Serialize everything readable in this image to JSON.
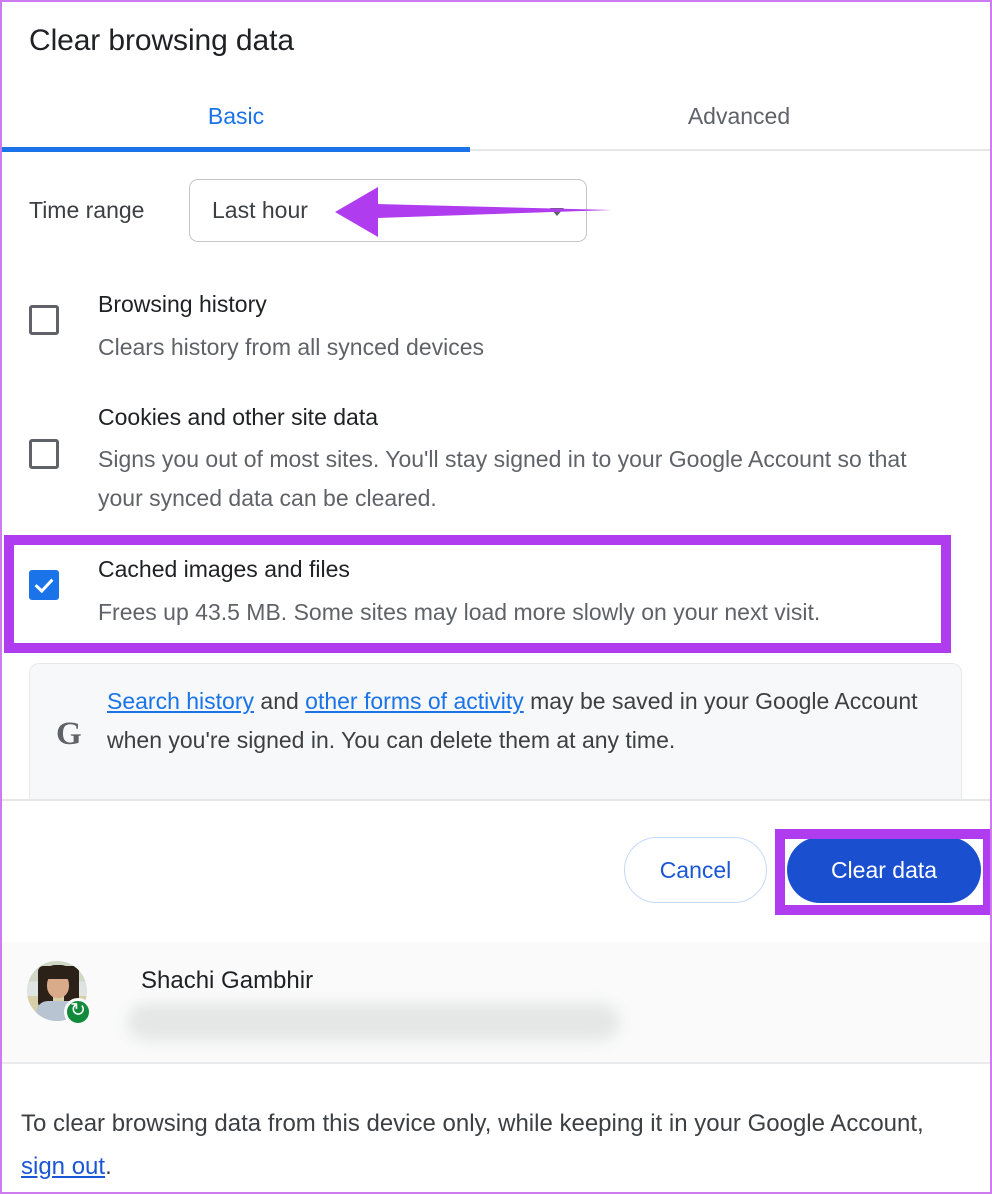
{
  "dialog": {
    "title": "Clear browsing data",
    "tabs": [
      {
        "label": "Basic",
        "active": true
      },
      {
        "label": "Advanced",
        "active": false
      }
    ],
    "time_range": {
      "label": "Time range",
      "selected": "Last hour",
      "caret_icon": "chevron-down-icon"
    },
    "options": [
      {
        "title": "Browsing history",
        "description": "Clears history from all synced devices",
        "checked": false
      },
      {
        "title": "Cookies and other site data",
        "description": "Signs you out of most sites. You'll stay signed in to your Google Account so that your synced data can be cleared.",
        "checked": false
      },
      {
        "title": "Cached images and files",
        "description": "Frees up 43.5 MB. Some sites may load more slowly on your next visit.",
        "checked": true
      }
    ],
    "google_info": {
      "icon": "google-g-icon",
      "link1": "Search history",
      "mid_text": " and ",
      "link2": "other forms of activity",
      "tail_text": " may be saved in your Google Account when you're signed in. You can delete them at any time."
    },
    "actions": {
      "cancel_label": "Cancel",
      "clear_label": "Clear data"
    }
  },
  "account": {
    "name": "Shachi Gambhir",
    "email_redacted": "",
    "avatar_icon": "user-avatar-photo",
    "sync_icon": "sync-badge-icon"
  },
  "bottom_note": {
    "prefix": "To clear browsing data from this device only, while keeping it in your Google Account, ",
    "link": "sign out",
    "suffix": "."
  },
  "annotations": {
    "color": "#b03cf0",
    "arrow_target": "time-range-dropdown",
    "highlighted": [
      "cached-images-and-files-row",
      "clear-data-button"
    ]
  }
}
